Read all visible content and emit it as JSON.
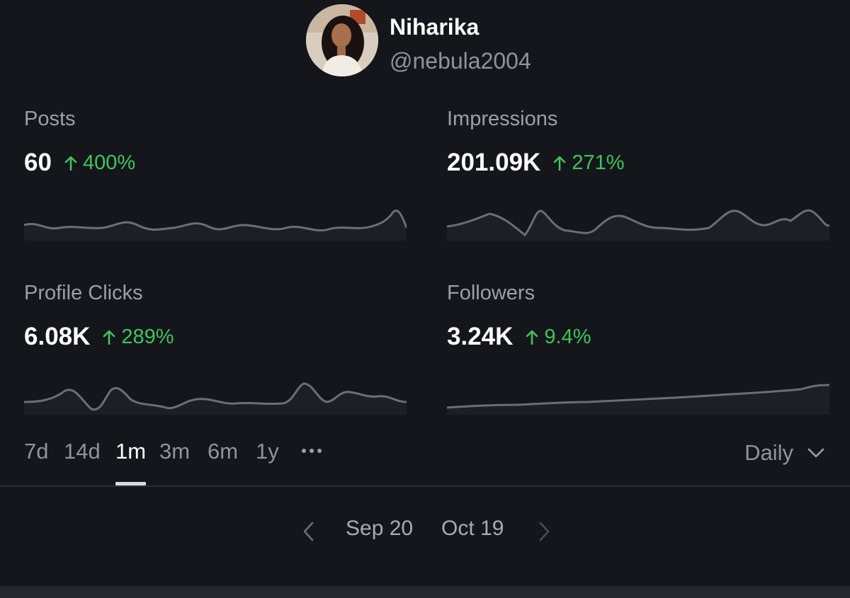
{
  "profile": {
    "name": "Niharika",
    "handle": "@nebula2004"
  },
  "metrics": [
    {
      "label": "Posts",
      "value": "60",
      "change": "400%",
      "trend": "up"
    },
    {
      "label": "Impressions",
      "value": "201.09K",
      "change": "271%",
      "trend": "up"
    },
    {
      "label": "Profile Clicks",
      "value": "6.08K",
      "change": "289%",
      "trend": "up"
    },
    {
      "label": "Followers",
      "value": "3.24K",
      "change": "9.4%",
      "trend": "up"
    }
  ],
  "ranges": {
    "options": [
      "7d",
      "14d",
      "1m",
      "3m",
      "6m",
      "1y"
    ],
    "selected": "1m",
    "more_icon": "more-horizontal-icon"
  },
  "interval": {
    "selected": "Daily",
    "icon": "chevron-down-icon"
  },
  "date_range": {
    "start": "Sep 20",
    "end": "Oct 19"
  },
  "colors": {
    "background": "#14161b",
    "positive": "#3fc45c",
    "sparkline": "#6a6f77",
    "muted_text": "#8e939c"
  }
}
